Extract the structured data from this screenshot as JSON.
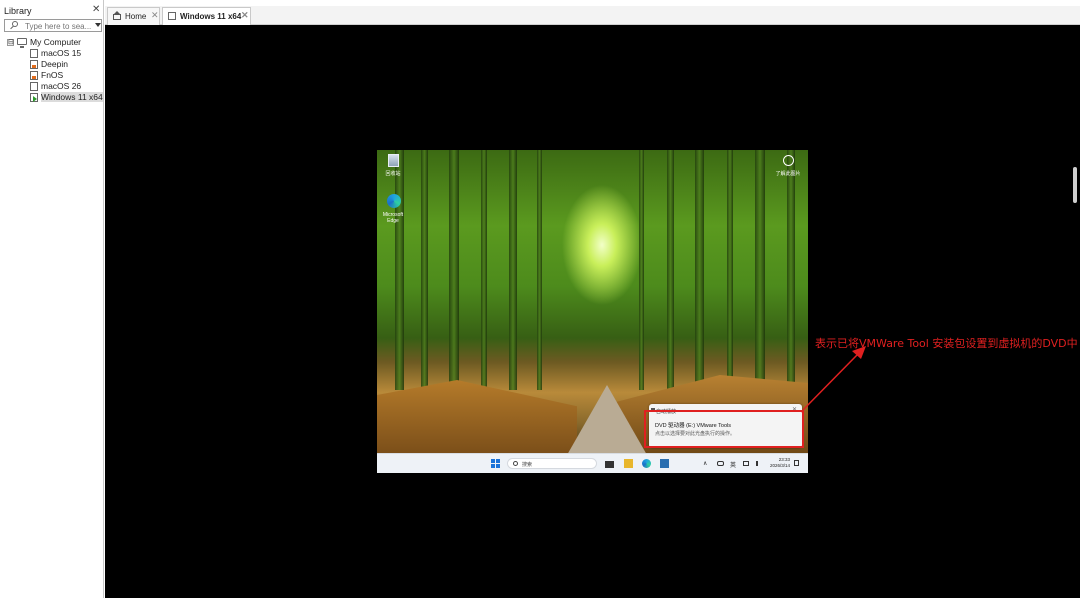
{
  "library": {
    "title": "Library",
    "close_glyph": "✕",
    "search_placeholder": "Type here to sea...",
    "tree": {
      "root": {
        "label": "My Computer",
        "collapse_glyph": "⊟"
      },
      "items": [
        {
          "label": "macOS 15",
          "state": "off"
        },
        {
          "label": "Deepin",
          "state": "warning"
        },
        {
          "label": "FnOS",
          "state": "warning"
        },
        {
          "label": "macOS 26",
          "state": "off"
        },
        {
          "label": "Windows 11 x64",
          "state": "running",
          "selected": true
        }
      ]
    }
  },
  "tabs": [
    {
      "label": "Home",
      "icon": "home-icon",
      "close": "✕",
      "active": false
    },
    {
      "label": "Windows 11 x64",
      "icon": "vm-running-icon",
      "close": "✕",
      "active": true
    }
  ],
  "guest": {
    "desktop_icons": [
      {
        "label": "回收站",
        "icon": "recycle-bin-icon"
      },
      {
        "label": "Microsoft Edge",
        "icon": "edge-icon"
      },
      {
        "label": "了解此图片",
        "icon": "about-picture-icon"
      }
    ],
    "notification": {
      "app": "自动播放",
      "close": "✕",
      "title": "DVD 驱动器 (E:) VMware Tools",
      "subtitle": "点击以选择要对此光盘执行的操作。"
    },
    "taskbar": {
      "search_text": "搜索",
      "tray_chevron": "∧",
      "ime": "英",
      "time": "23:33",
      "date": "2026/3/14"
    }
  },
  "annotation": {
    "text": "表示已将VMWare Tool 安装包设置到虚拟机的DVD中",
    "color": "#e02020"
  },
  "colors": {
    "console_bg": "#000000",
    "highlight": "#e02020",
    "windows_blue": "#1a73d9"
  }
}
